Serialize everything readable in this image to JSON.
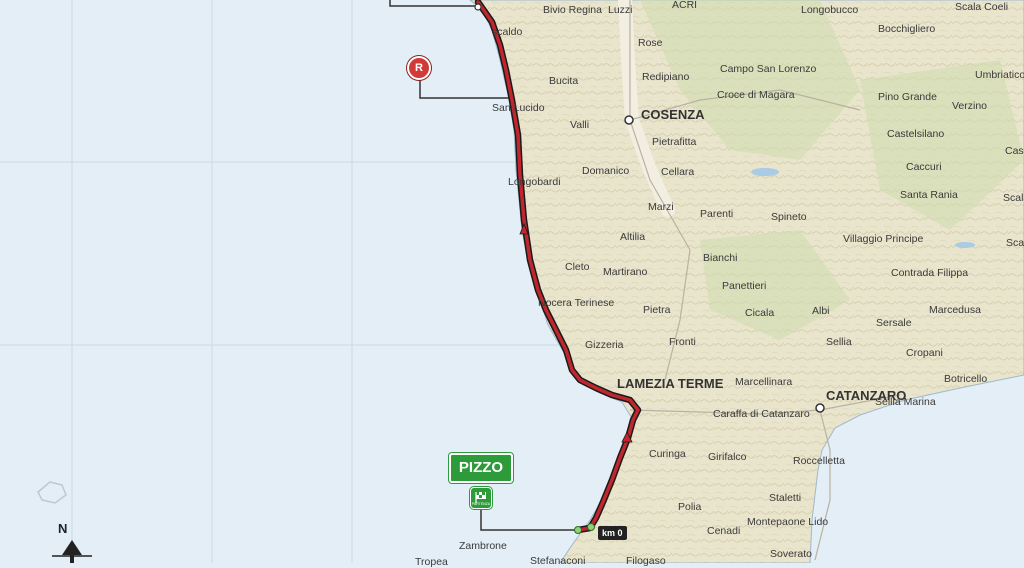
{
  "start": {
    "label": "PIZZO",
    "badge_text": "PARTENZA",
    "km_label": "km 0"
  },
  "checkpoint": {
    "label": "R"
  },
  "compass": {
    "label": "N"
  },
  "colors": {
    "sea": "#e3eef7",
    "land": "#e8e4cf",
    "route": "#c0262d",
    "start": "#2e9b3b"
  },
  "places": [
    {
      "name": "Bivio Regina",
      "style": "normal"
    },
    {
      "name": "Luzzi",
      "style": "normal"
    },
    {
      "name": "ACRI",
      "style": "normal"
    },
    {
      "name": "Longobucco",
      "style": "normal"
    },
    {
      "name": "Scala Coeli",
      "style": "normal"
    },
    {
      "name": "scaldo",
      "style": "normal"
    },
    {
      "name": "Rose",
      "style": "normal"
    },
    {
      "name": "Bocchigliero",
      "style": "normal"
    },
    {
      "name": "Campo San Lorenzo",
      "style": "normal"
    },
    {
      "name": "Umbriatico",
      "style": "normal"
    },
    {
      "name": "Bucita",
      "style": "normal"
    },
    {
      "name": "Redipiano",
      "style": "normal"
    },
    {
      "name": "Croce di Magara",
      "style": "normal"
    },
    {
      "name": "Pino Grande",
      "style": "normal"
    },
    {
      "name": "Verzino",
      "style": "normal"
    },
    {
      "name": "San Lucido",
      "style": "normal"
    },
    {
      "name": "COSENZA",
      "style": "big"
    },
    {
      "name": "Valli",
      "style": "normal"
    },
    {
      "name": "Pietrafitta",
      "style": "normal"
    },
    {
      "name": "Castelsilano",
      "style": "normal"
    },
    {
      "name": "Casal",
      "style": "normal"
    },
    {
      "name": "Caccuri",
      "style": "normal"
    },
    {
      "name": "Domanico",
      "style": "normal"
    },
    {
      "name": "Cellara",
      "style": "normal"
    },
    {
      "name": "Longobardi",
      "style": "normal"
    },
    {
      "name": "Santa Rania",
      "style": "normal"
    },
    {
      "name": "Scala Coeli",
      "style": "normal"
    },
    {
      "name": "Marzi",
      "style": "normal"
    },
    {
      "name": "Parenti",
      "style": "normal"
    },
    {
      "name": "Spineto",
      "style": "normal"
    },
    {
      "name": "Altilia",
      "style": "normal"
    },
    {
      "name": "Villaggio Principe",
      "style": "normal"
    },
    {
      "name": "Scar",
      "style": "normal"
    },
    {
      "name": "Bianchi",
      "style": "normal"
    },
    {
      "name": "Cleto",
      "style": "normal"
    },
    {
      "name": "Martirano",
      "style": "normal"
    },
    {
      "name": "Contrada Filippa",
      "style": "normal"
    },
    {
      "name": "Panettieri",
      "style": "normal"
    },
    {
      "name": "Nocera Terinese",
      "style": "normal"
    },
    {
      "name": "Marcedusa",
      "style": "normal"
    },
    {
      "name": "Pietra",
      "style": "normal"
    },
    {
      "name": "Cicala",
      "style": "normal"
    },
    {
      "name": "Albi",
      "style": "normal"
    },
    {
      "name": "Sersale",
      "style": "normal"
    },
    {
      "name": "Gizzeria",
      "style": "normal"
    },
    {
      "name": "Fronti",
      "style": "normal"
    },
    {
      "name": "Sellia",
      "style": "normal"
    },
    {
      "name": "Cropani",
      "style": "normal"
    },
    {
      "name": "LAMEZIA TERME",
      "style": "big"
    },
    {
      "name": "Marcellinara",
      "style": "normal"
    },
    {
      "name": "CATANZARO",
      "style": "big"
    },
    {
      "name": "Botricello",
      "style": "normal"
    },
    {
      "name": "Sellia Marina",
      "style": "normal"
    },
    {
      "name": "Caraffa di Catanzaro",
      "style": "normal"
    },
    {
      "name": "Curinga",
      "style": "normal"
    },
    {
      "name": "Girifalco",
      "style": "normal"
    },
    {
      "name": "Roccelletta",
      "style": "normal"
    },
    {
      "name": "Staletti",
      "style": "normal"
    },
    {
      "name": "Polia",
      "style": "normal"
    },
    {
      "name": "Montepaone Lido",
      "style": "normal"
    },
    {
      "name": "Cenadi",
      "style": "normal"
    },
    {
      "name": "Zambrone",
      "style": "normal"
    },
    {
      "name": "Soverato",
      "style": "normal"
    },
    {
      "name": "Tropea",
      "style": "normal"
    },
    {
      "name": "Stefanaconi",
      "style": "normal"
    },
    {
      "name": "Filogaso",
      "style": "normal"
    }
  ]
}
